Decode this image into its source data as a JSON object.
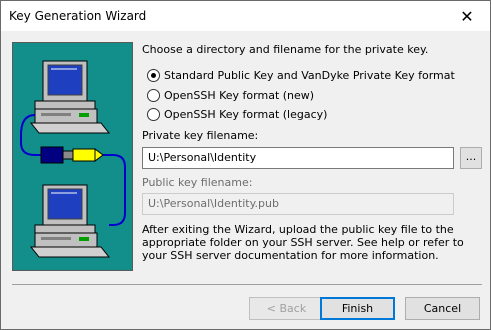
{
  "window": {
    "title": "Key Generation Wizard",
    "close_glyph": "✕"
  },
  "instruction": "Choose a directory and filename for the private key.",
  "formats": [
    {
      "label": "Standard Public Key and VanDyke Private Key format",
      "checked": true
    },
    {
      "label": "OpenSSH Key format (new)",
      "checked": false
    },
    {
      "label": "OpenSSH Key format (legacy)",
      "checked": false
    }
  ],
  "private_key": {
    "label": "Private key filename:",
    "value": "U:\\Personal\\Identity",
    "browse_label": "..."
  },
  "public_key": {
    "label": "Public key filename:",
    "value": "U:\\Personal\\Identity.pub"
  },
  "info_text": "After exiting the Wizard, upload the public key file to the appropriate folder on your SSH server.  See help or refer to your SSH server documentation for more information.",
  "buttons": {
    "back": "< Back",
    "finish": "Finish",
    "cancel": "Cancel"
  },
  "icons": {
    "close": "close-icon",
    "illustration": "computers-key-illustration"
  },
  "colors": {
    "illustration_bg": "#128f8b",
    "default_button_border": "#0078d7"
  }
}
